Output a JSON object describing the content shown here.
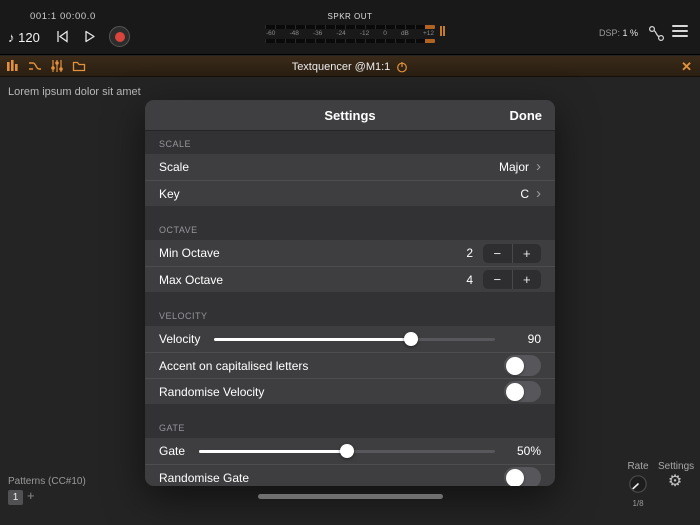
{
  "colors": {
    "accent_orange": "#e2913c",
    "record_red": "#d9443c"
  },
  "transport": {
    "time_display": "001:1 00:00.0",
    "tempo_note": "♪",
    "tempo": "120",
    "output_label": "SPKR OUT",
    "meter_ticks": [
      "-60",
      "-48",
      "-36",
      "-24",
      "-12",
      "0",
      "dB",
      "+12"
    ],
    "dsp_label": "DSP:",
    "dsp_value": "1 %"
  },
  "plugin_bar": {
    "title": "Textquencer @M1:1"
  },
  "canvas": {
    "content": "Lorem ipsum dolor sit amet"
  },
  "modal": {
    "title": "Settings",
    "done": "Done",
    "chevron": "›",
    "stepper": {
      "minus": "−",
      "plus": "+"
    },
    "sections": {
      "scale": "SCALE",
      "octave": "OCTAVE",
      "velocity": "VELOCITY",
      "gate": "GATE"
    },
    "rows": {
      "scale": {
        "label": "Scale",
        "value": "Major"
      },
      "key": {
        "label": "Key",
        "value": "C"
      },
      "min_octave": {
        "label": "Min Octave",
        "value": "2"
      },
      "max_octave": {
        "label": "Max Octave",
        "value": "4"
      },
      "velocity": {
        "label": "Velocity",
        "value": "90",
        "knob_percent": 70
      },
      "accent": {
        "label": "Accent on capitalised letters",
        "state": "off"
      },
      "randomise_velocity": {
        "label": "Randomise Velocity",
        "state": "off"
      },
      "gate": {
        "label": "Gate",
        "value": "50%",
        "knob_percent": 50
      },
      "randomise_gate": {
        "label": "Randomise Gate",
        "state": "off"
      }
    }
  },
  "bottom": {
    "patterns_label": "Patterns (CC#10)",
    "pattern_1": "1",
    "add_pattern": "+",
    "rate_label": "Rate",
    "rate_value": "1/8",
    "settings_label": "Settings"
  }
}
